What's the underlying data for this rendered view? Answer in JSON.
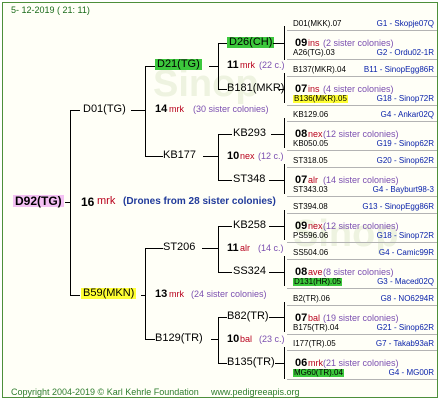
{
  "header": {
    "date": "5- 12-2019 ( 21: 11)"
  },
  "root": {
    "name": "D92(TG)",
    "gen": "16",
    "mark": "mrk",
    "drones": "(Drones from 28 sister colonies)"
  },
  "l1": [
    {
      "name": "D01(TG)",
      "gen": "14",
      "mark": "mrk",
      "sis": "(30 sister colonies)"
    },
    {
      "name": "B59(MKN)",
      "gen": "13",
      "mark": "mrk",
      "sis": "(24 sister colonies)"
    }
  ],
  "l2": [
    {
      "name": "D21(TG)",
      "gen": "11",
      "mark": "mrk",
      "sis": "(22 c.)"
    },
    {
      "name": "KB177",
      "gen": "10",
      "mark": "nex",
      "sis": "(12 c.)"
    },
    {
      "name": "ST206",
      "gen": "11",
      "mark": "alr",
      "sis": "(14 c.)"
    },
    {
      "name": "B129(TR)",
      "gen": "10",
      "mark": "bal",
      "sis": "(23 c.)"
    }
  ],
  "l3": [
    {
      "name": "D26(CH)",
      "gen": "09",
      "mark": "ins",
      "sis": "(2 sister colonies)"
    },
    {
      "name": "B181(MKR)",
      "gen": "07",
      "mark": "ins",
      "sis": "(4 sister colonies)"
    },
    {
      "name": "KB293",
      "gen": "08",
      "mark": "nex",
      "sis": "(12 sister colonies)"
    },
    {
      "name": "ST348",
      "gen": "07",
      "mark": "alr",
      "sis": "(14 sister colonies)"
    },
    {
      "name": "KB258",
      "gen": "09",
      "mark": "nex",
      "sis": "(12 sister colonies)"
    },
    {
      "name": "SS324",
      "gen": "08",
      "mark": "ave",
      "sis": "(8 sister colonies)"
    },
    {
      "name": "B82(TR)",
      "gen": "07",
      "mark": "bal",
      "sis": "(19 sister colonies)"
    },
    {
      "name": "B135(TR)",
      "gen": "06",
      "mark": "mrk",
      "sis": "(21 sister colonies)"
    }
  ],
  "l4": [
    {
      "name": "D01(MKK).07",
      "code": "G1 - Skopje07Q"
    },
    {
      "name": "A26(TG).03",
      "code": "G2 - Ordu02-1R"
    },
    {
      "name": "B137(MKR).04",
      "code": "B11 - SinopEgg86R"
    },
    {
      "name": "B136(MKR).05",
      "code": "G18 - Sinop72R",
      "hl": "y"
    },
    {
      "name": "KB129.06",
      "code": "G4 - Ankar02Q"
    },
    {
      "name": "KB050.05",
      "code": "G19 - Sinop62R"
    },
    {
      "name": "ST318.05",
      "code": "G20 - Sinop62R"
    },
    {
      "name": "ST343.03",
      "code": "G4 - Bayburt98-3"
    },
    {
      "name": "ST394.08",
      "code": "G13 - SinopEgg86R"
    },
    {
      "name": "PS596.06",
      "code": "G18 - Sinop72R"
    },
    {
      "name": "SS504.06",
      "code": "G4 - Camic99R"
    },
    {
      "name": "D131(HR).05",
      "code": "G3 - Maced02Q",
      "hl": "g"
    },
    {
      "name": "B2(TR).06",
      "code": "G8 - NO6294R"
    },
    {
      "name": "B175(TR).04",
      "code": "G21 - Sinop62R"
    },
    {
      "name": "I177(TR).05",
      "code": "G7 - Takab93aR"
    },
    {
      "name": "MG60(TR).04",
      "code": "G4 - MG00R",
      "hl": "g"
    }
  ],
  "footer": {
    "copyright": "Copyright 2004-2019 © Karl Kehrle Foundation",
    "site": "www.pedigreeapis.org"
  }
}
